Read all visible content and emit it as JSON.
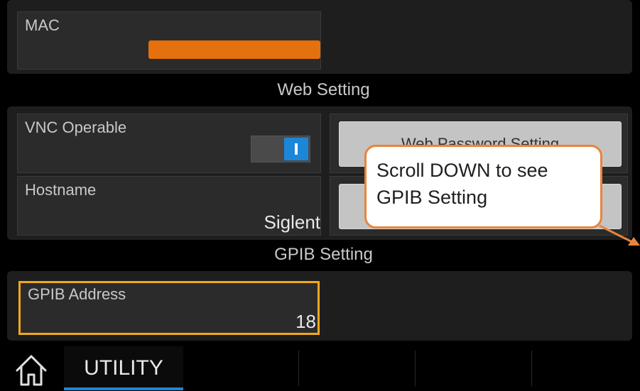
{
  "mac": {
    "label": "MAC",
    "value_hidden_color": "#E4700E"
  },
  "sections": {
    "web": "Web Setting",
    "gpib": "GPIB Setting"
  },
  "vnc": {
    "label": "VNC Operable",
    "state": "on"
  },
  "hostname": {
    "label": "Hostname",
    "value": "Siglent"
  },
  "buttons": {
    "web_password": "Web Password Setting"
  },
  "callout": {
    "line1": "Scroll DOWN to see",
    "line2": "GPIB Setting",
    "border_color": "#E8843C"
  },
  "gpib": {
    "label": "GPIB Address",
    "value": "18",
    "highlight_color": "#F0A81E"
  },
  "bottom_bar": {
    "active_tab": "UTILITY",
    "home_icon": "home-icon"
  },
  "colors": {
    "accent": "#1C86D9",
    "background": "#000000",
    "panel": "#2B2B2B"
  }
}
